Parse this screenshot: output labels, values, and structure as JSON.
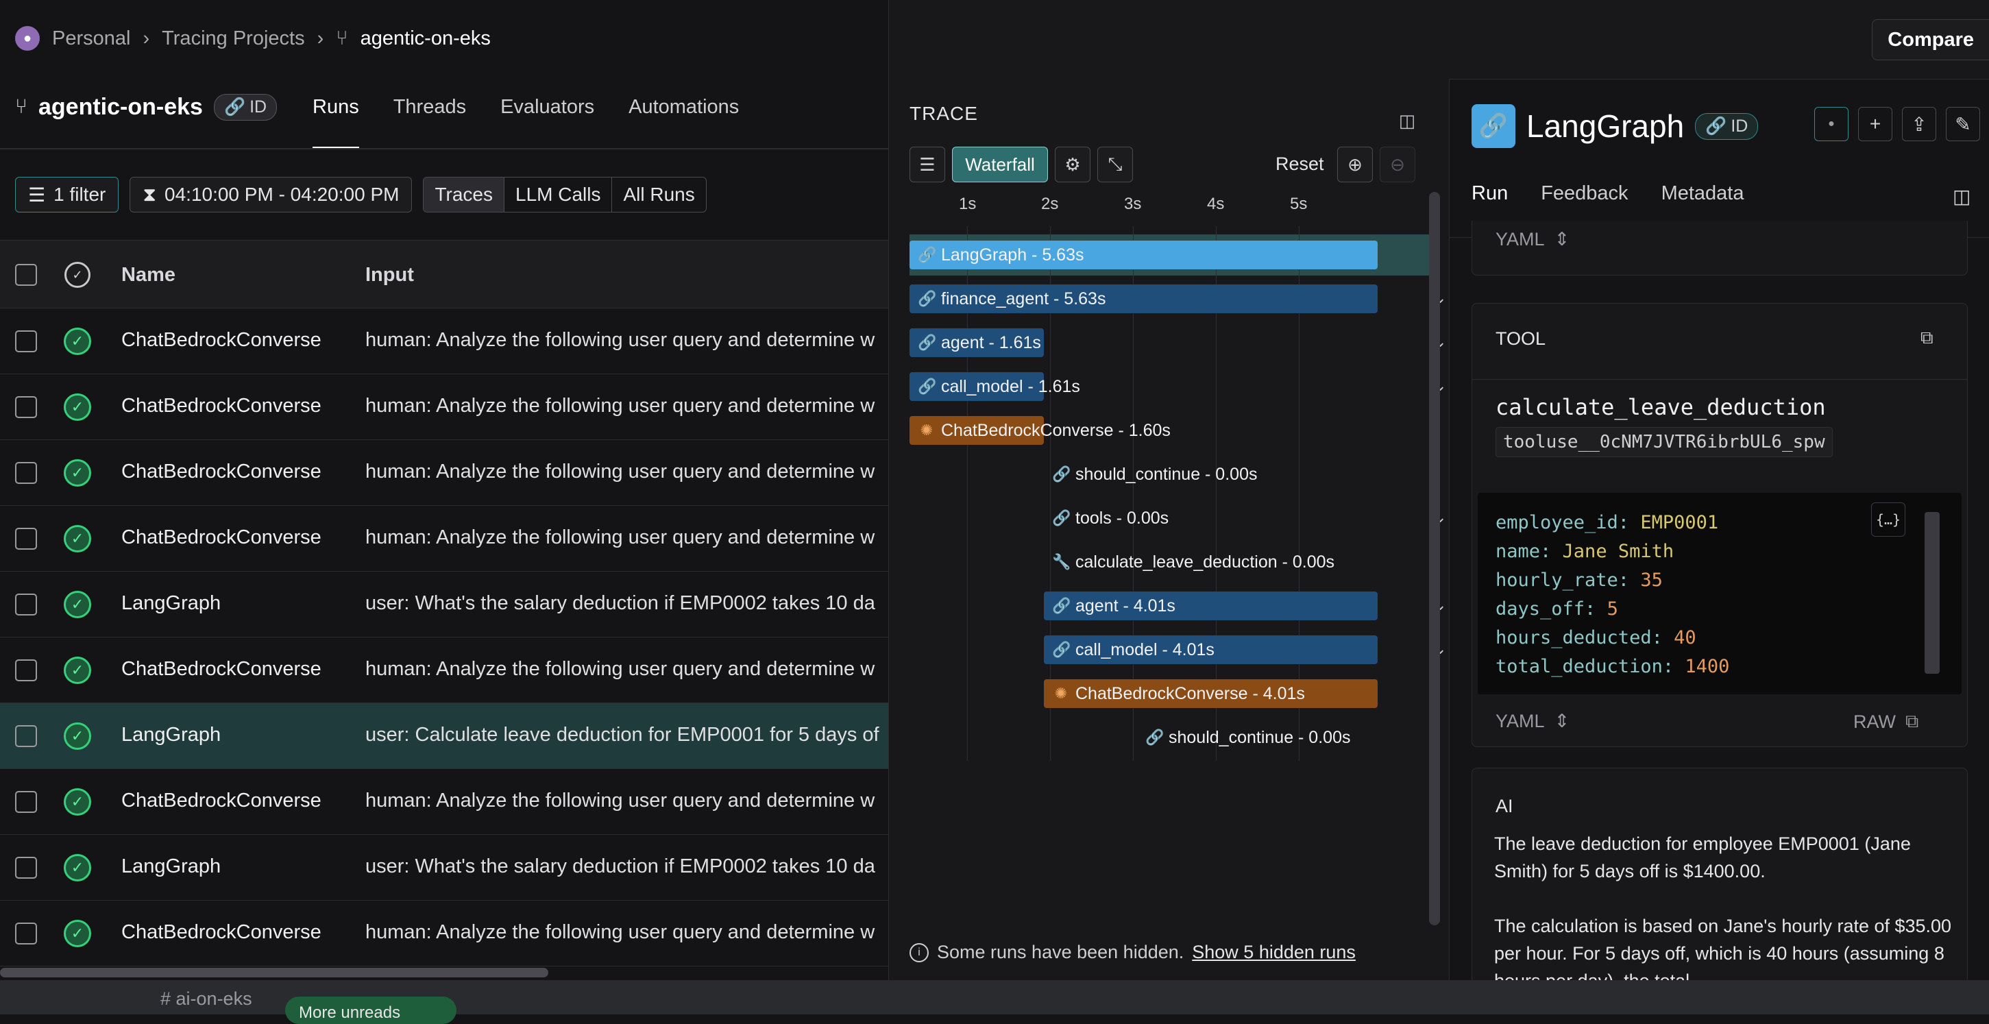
{
  "breadcrumb": {
    "workspace": "Personal",
    "section": "Tracing Projects",
    "project": "agentic-on-eks"
  },
  "project_header": {
    "title": "agentic-on-eks",
    "id_label": "ID"
  },
  "tabs": [
    "Runs",
    "Threads",
    "Evaluators",
    "Automations"
  ],
  "filters": {
    "filter_label": "1 filter",
    "time_range": "04:10:00 PM - 04:20:00 PM",
    "segments": [
      "Traces",
      "LLM Calls",
      "All Runs"
    ]
  },
  "table": {
    "headers": {
      "name": "Name",
      "input": "Input"
    },
    "rows": [
      {
        "name": "ChatBedrockConverse",
        "input": "human: Analyze the following user query and determine w"
      },
      {
        "name": "ChatBedrockConverse",
        "input": "human: Analyze the following user query and determine w"
      },
      {
        "name": "ChatBedrockConverse",
        "input": "human: Analyze the following user query and determine w"
      },
      {
        "name": "ChatBedrockConverse",
        "input": "human: Analyze the following user query and determine w"
      },
      {
        "name": "LangGraph",
        "input": "user: What's the salary deduction if EMP0002 takes 10 da"
      },
      {
        "name": "ChatBedrockConverse",
        "input": "human: Analyze the following user query and determine w"
      },
      {
        "name": "LangGraph",
        "input": "user: Calculate leave deduction for EMP0001 for 5 days of"
      },
      {
        "name": "ChatBedrockConverse",
        "input": "human: Analyze the following user query and determine w"
      },
      {
        "name": "LangGraph",
        "input": "user: What's the salary deduction if EMP0002 takes 10 da"
      },
      {
        "name": "ChatBedrockConverse",
        "input": "human: Analyze the following user query and determine w"
      }
    ]
  },
  "slack": {
    "channel": "ai-on-eks",
    "more_unreads": "More unreads"
  },
  "topbar": {
    "compare": "Compare"
  },
  "trace": {
    "label": "TRACE",
    "waterfall": "Waterfall",
    "reset": "Reset",
    "axis": [
      "1s",
      "2s",
      "3s",
      "4s",
      "5s"
    ],
    "spans": [
      {
        "label": "LangGraph - 5.63s"
      },
      {
        "label": "finance_agent - 5.63s"
      },
      {
        "label": "agent - 1.61s"
      },
      {
        "label": "call_model - 1.61s"
      },
      {
        "label": "ChatBedrockConverse - 1.60s"
      },
      {
        "label": "should_continue - 0.00s"
      },
      {
        "label": "tools - 0.00s"
      },
      {
        "label": "calculate_leave_deduction - 0.00s"
      },
      {
        "label": "agent - 4.01s"
      },
      {
        "label": "call_model - 4.01s"
      },
      {
        "label": "ChatBedrockConverse - 4.01s"
      },
      {
        "label": "should_continue - 0.00s"
      }
    ],
    "hidden_note": "Some runs have been hidden.",
    "hidden_link": "Show 5 hidden runs"
  },
  "run_panel": {
    "title": "LangGraph",
    "id_label": "ID",
    "tabs": [
      "Run",
      "Feedback",
      "Metadata"
    ],
    "yaml_label": "YAML",
    "tool_section": "TOOL",
    "tool_name": "calculate_leave_deduction",
    "tool_id": "tooluse__0cNM7JVTR6ibrbUL6_spw",
    "tool_args": [
      {
        "key": "employee_id:",
        "value": "EMP0001"
      },
      {
        "key": "name:",
        "value": "Jane Smith"
      },
      {
        "key": "hourly_rate:",
        "value": "35"
      },
      {
        "key": "days_off:",
        "value": "5"
      },
      {
        "key": "hours_deducted:",
        "value": "40"
      },
      {
        "key": "total_deduction:",
        "value": "1400"
      }
    ],
    "raw_label": "RAW",
    "ai_section": "AI",
    "ai_paragraph1": "The leave deduction for employee EMP0001 (Jane Smith) for 5 days off is $1400.00.",
    "ai_paragraph2": "The calculation is based on Jane's hourly rate of $35.00 per hour. For 5 days off, which is 40 hours (assuming 8 hours per day), the total"
  }
}
